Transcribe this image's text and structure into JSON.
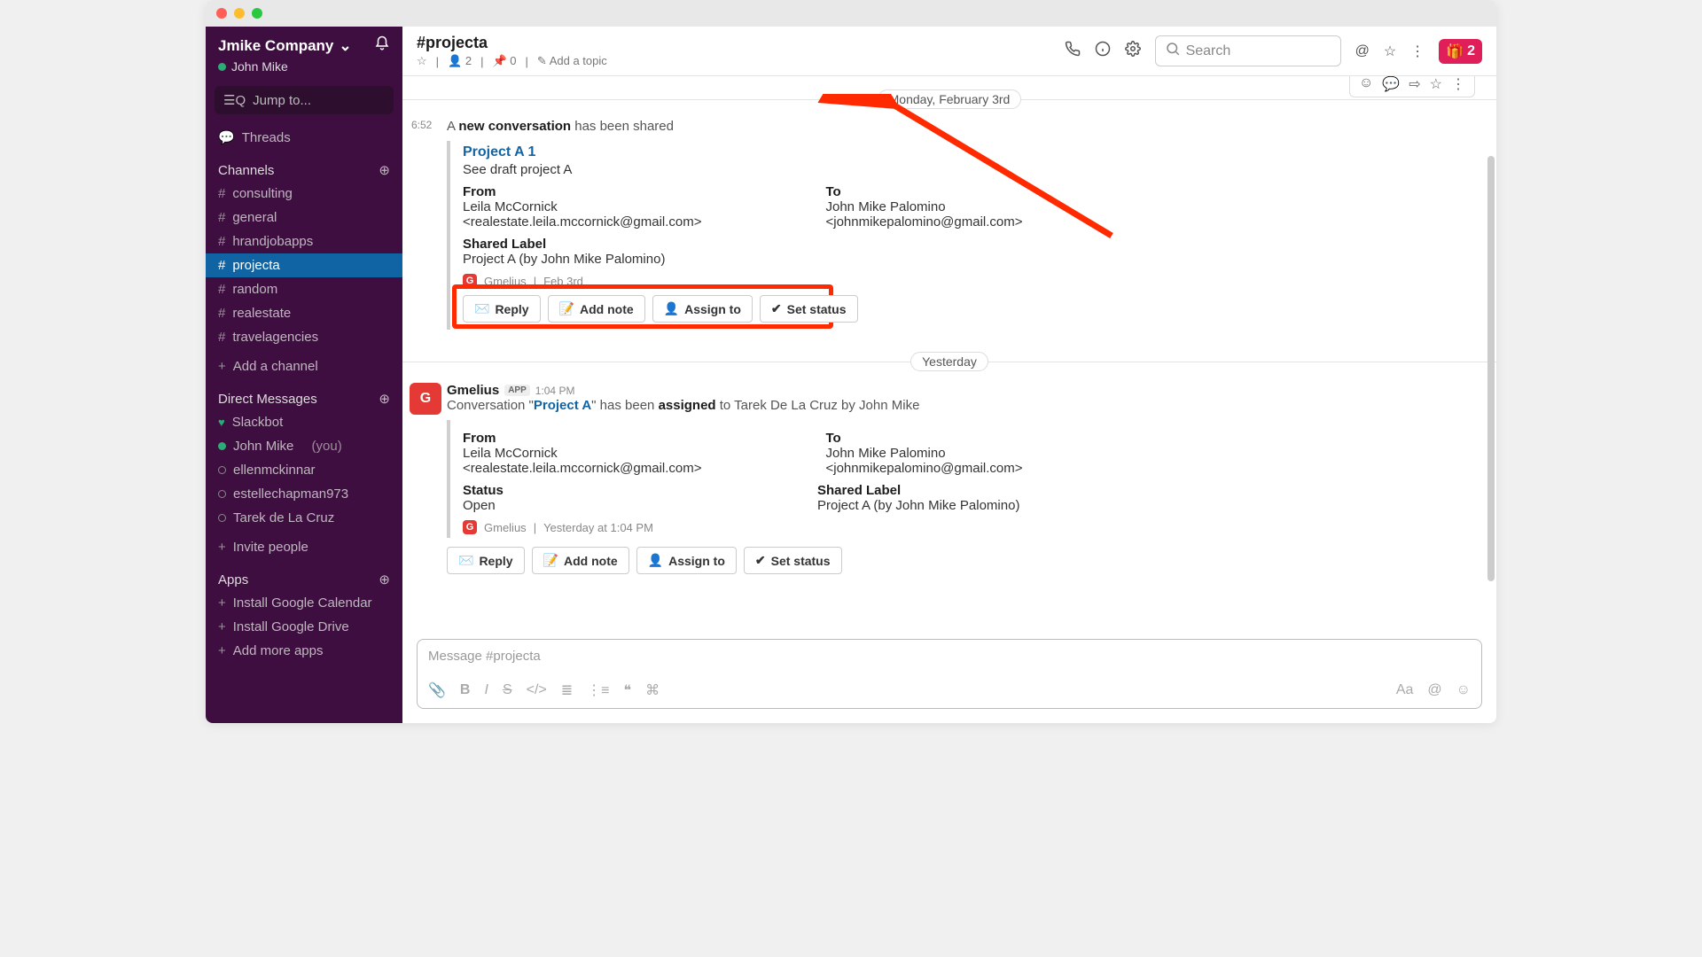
{
  "workspace": {
    "name": "Jmike Company",
    "user": "John Mike"
  },
  "jump": "Jump to...",
  "threads": "Threads",
  "channels_label": "Channels",
  "channels": [
    "consulting",
    "general",
    "hrandjobapps",
    "projecta",
    "random",
    "realestate",
    "travelagencies"
  ],
  "add_channel": "Add a channel",
  "dm_label": "Direct Messages",
  "dms": [
    {
      "name": "Slackbot",
      "heart": true
    },
    {
      "name": "John Mike",
      "you": "(you)",
      "online": true
    },
    {
      "name": "ellenmckinnar"
    },
    {
      "name": "estellechapman973"
    },
    {
      "name": "Tarek de La Cruz"
    }
  ],
  "invite": "Invite people",
  "apps_label": "Apps",
  "apps": [
    "Install Google Calendar",
    "Install Google Drive",
    "Add more apps"
  ],
  "channel": {
    "title": "#projecta",
    "members": "2",
    "pins": "0",
    "topic": "Add a topic"
  },
  "search_ph": "Search",
  "gift_count": "2",
  "divider1": "Monday, February 3rd",
  "divider2": "Yesterday",
  "m1": {
    "ts": "6:52",
    "prefix": "A ",
    "bold": "new conversation",
    "suffix": " has been shared",
    "link": "Project A 1",
    "sub": "See draft project A",
    "from_lbl": "From",
    "from_val1": "Leila McCornick",
    "from_val2": "<realestate.leila.mccornick@gmail.com>",
    "to_lbl": "To",
    "to_val1": "John Mike Palomino",
    "to_val2": "<johnmikepalomino@gmail.com>",
    "shared_lbl": "Shared Label",
    "shared_val": "Project A (by John Mike Palomino)",
    "app": "Gmelius",
    "date": "Feb 3rd"
  },
  "m2": {
    "author": "Gmelius",
    "badge": "APP",
    "time": "1:04 PM",
    "t1": "Conversation \"",
    "link": "Project A",
    "t2": "\" has been ",
    "bold": "assigned",
    "t3": " to Tarek De La Cruz by John Mike",
    "from_lbl": "From",
    "from_val1": "Leila McCornick",
    "from_val2": "<realestate.leila.mccornick@gmail.com>",
    "to_lbl": "To",
    "to_val1": "John Mike Palomino",
    "to_val2": "<johnmikepalomino@gmail.com>",
    "status_lbl": "Status",
    "status_val": "Open",
    "shared_lbl": "Shared Label",
    "shared_val": "Project A (by John Mike Palomino)",
    "app": "Gmelius",
    "date": "Yesterday at 1:04 PM"
  },
  "buttons": {
    "reply": "Reply",
    "note": "Add note",
    "assign": "Assign to",
    "status": "Set status"
  },
  "composer_ph": "Message #projecta"
}
